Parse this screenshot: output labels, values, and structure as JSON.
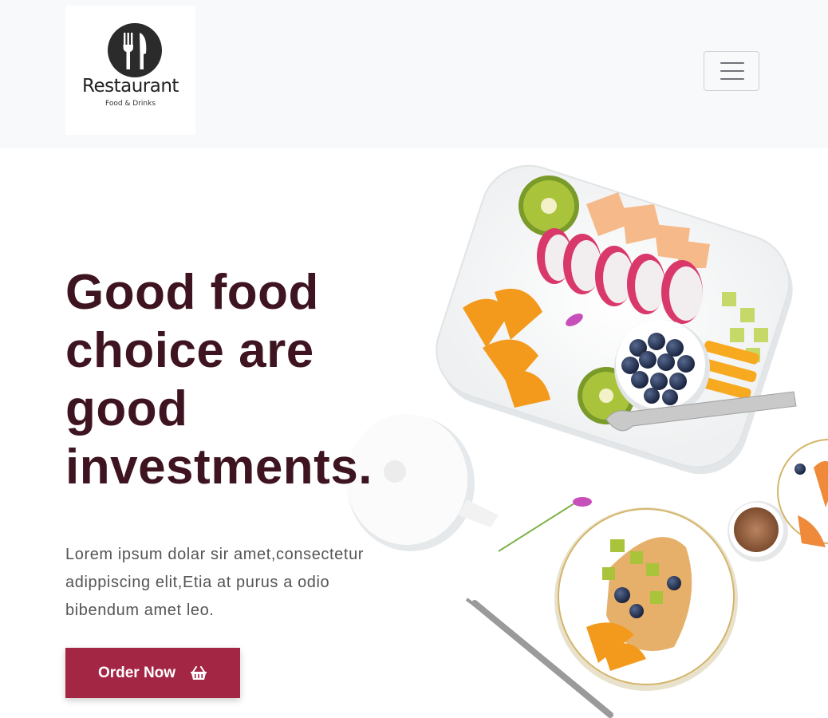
{
  "brand": {
    "name": "Restaurant",
    "tagline": "Food & Drinks",
    "logo_icon": "fork-knife-icon"
  },
  "navbar": {
    "toggler_icon": "hamburger-menu-icon"
  },
  "hero": {
    "headline": "Good food choice are good investments.",
    "lead": "Lorem ipsum dolar sir amet,consectetur adippiscing elit,Etia at purus a odio bibendum amet leo.",
    "cta_label": "Order Now",
    "cta_icon": "shopping-basket-icon",
    "image": "food-platter-illustration"
  },
  "colors": {
    "headline": "#3d1420",
    "accent": "#a32645",
    "navbar_bg": "#f8f9fa",
    "body_text": "#555555"
  }
}
